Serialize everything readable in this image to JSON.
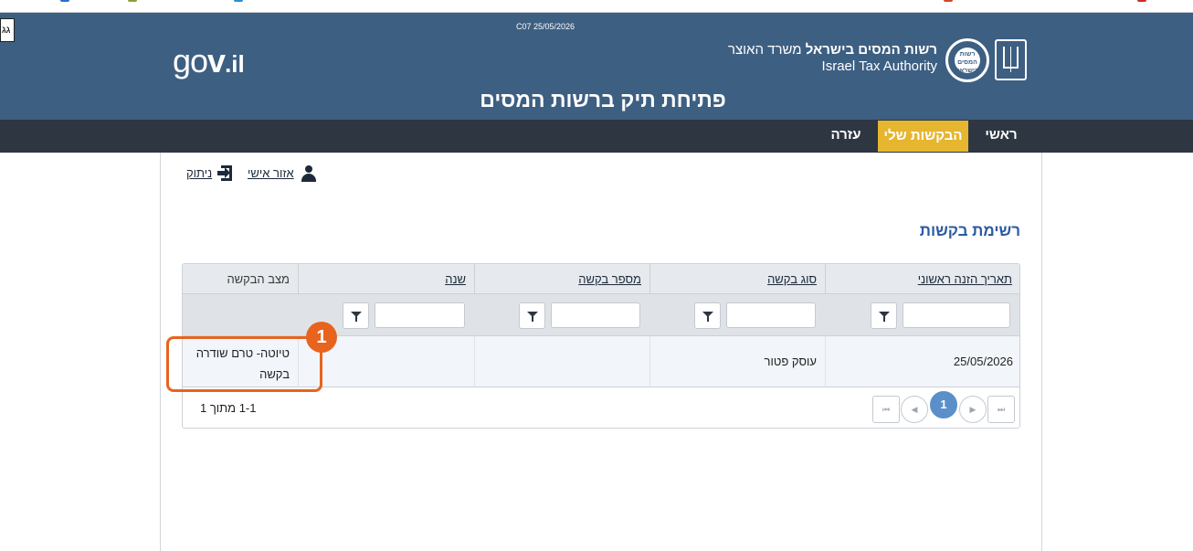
{
  "header": {
    "skip_label": "גג",
    "version": "C07 25/05/2026",
    "govil_logo": {
      "prefix": "go",
      "v": "v",
      "suffix": ".il"
    },
    "agency_he_bold": "רשות המסים בישראל",
    "agency_he_rest": "משרד האוצר",
    "agency_en": "Israel Tax Authority",
    "seal_text": "רשות המסים בישראל",
    "title": "פתיחת תיק ברשות המסים"
  },
  "nav": {
    "main": "ראשי",
    "my_requests": "הבקשות שלי",
    "help": "עזרה",
    "active_color": "#e6b630"
  },
  "user_links": {
    "personal_area": "אזור אישי",
    "logout": "ניתוק"
  },
  "section": {
    "title": "רשימת בקשות"
  },
  "table": {
    "columns": [
      {
        "label": "תאריך הזנה ראשוני",
        "sortable": true
      },
      {
        "label": "סוג בקשה",
        "sortable": true
      },
      {
        "label": "מספר בקשה",
        "sortable": true
      },
      {
        "label": "שנה",
        "sortable": true
      },
      {
        "label": "מצב הבקשה",
        "sortable": false
      }
    ],
    "rows": [
      {
        "date": "25/05/2026",
        "type": "עוסק פטור",
        "number": "",
        "year": "",
        "status_line1": "טיוטה- טרם שודרה",
        "status_line2": "בקשה"
      }
    ],
    "pager": {
      "current_page": "1",
      "info": "1-1 מתוך 1"
    }
  },
  "annotation": {
    "badge": "1",
    "color": "#e8641e"
  },
  "colors": {
    "header_bg": "#3d5f82",
    "nav_bg": "#2d3641",
    "link_blue": "#2a5ba0",
    "pager_active": "#5b8fc9"
  }
}
